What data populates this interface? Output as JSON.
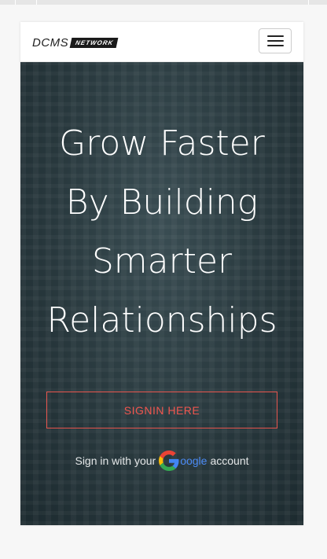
{
  "brand": {
    "name": "DCMS",
    "badge": "NETWORK"
  },
  "navbar": {
    "menu_icon": "hamburger-menu-icon"
  },
  "hero": {
    "title_lines": [
      "Grow Faster",
      "By Building",
      "Smarter",
      "Relationships"
    ],
    "signin_label": "SIGNIN HERE",
    "note_prefix": "Sign in with your",
    "note_google": "oogle",
    "note_suffix": "account"
  },
  "colors": {
    "accent": "#f0564f",
    "google_blue": "#4a8af4",
    "hero_bg": "#28383d"
  }
}
